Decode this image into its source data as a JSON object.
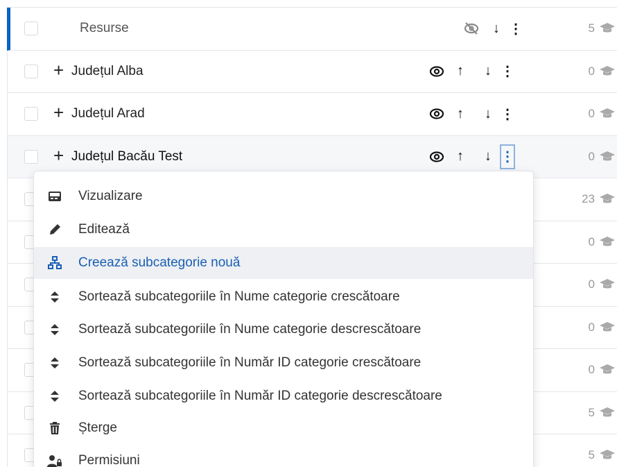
{
  "rows": [
    {
      "name": "Resurse",
      "count": "5"
    },
    {
      "name": "Județul Alba",
      "count": "0"
    },
    {
      "name": "Județul Arad",
      "count": "0"
    },
    {
      "name": "Județul Bacău Test",
      "count": "0"
    },
    {
      "name": "",
      "count": "23"
    },
    {
      "name": "",
      "count": "0"
    },
    {
      "name": "",
      "count": "0"
    },
    {
      "name": "",
      "count": "0"
    },
    {
      "name": "",
      "count": "0"
    },
    {
      "name": "",
      "count": "5"
    },
    {
      "name": "",
      "count": "5"
    }
  ],
  "menu": {
    "items": [
      {
        "label": "Vizualizare",
        "icon": "view-icon"
      },
      {
        "label": "Editează",
        "icon": "pencil-icon"
      },
      {
        "label": "Creează subcategorie nouă",
        "icon": "sitemap-icon"
      },
      {
        "label": "Sortează subcategoriile în Nume categorie crescătoare",
        "icon": "sort-icon"
      },
      {
        "label": "Sortează subcategoriile în Nume categorie descrescătoare",
        "icon": "sort-icon"
      },
      {
        "label": "Sortează subcategoriile în Număr ID categorie crescătoare",
        "icon": "sort-icon"
      },
      {
        "label": "Sortează subcategoriile în Număr ID categorie descrescătoare",
        "icon": "sort-icon"
      },
      {
        "label": "Șterge",
        "icon": "trash-icon"
      },
      {
        "label": "Permisiuni",
        "icon": "user-lock-icon"
      }
    ]
  },
  "colors": {
    "accent": "#0b62c4",
    "highlight_text": "#1a5fb4"
  }
}
